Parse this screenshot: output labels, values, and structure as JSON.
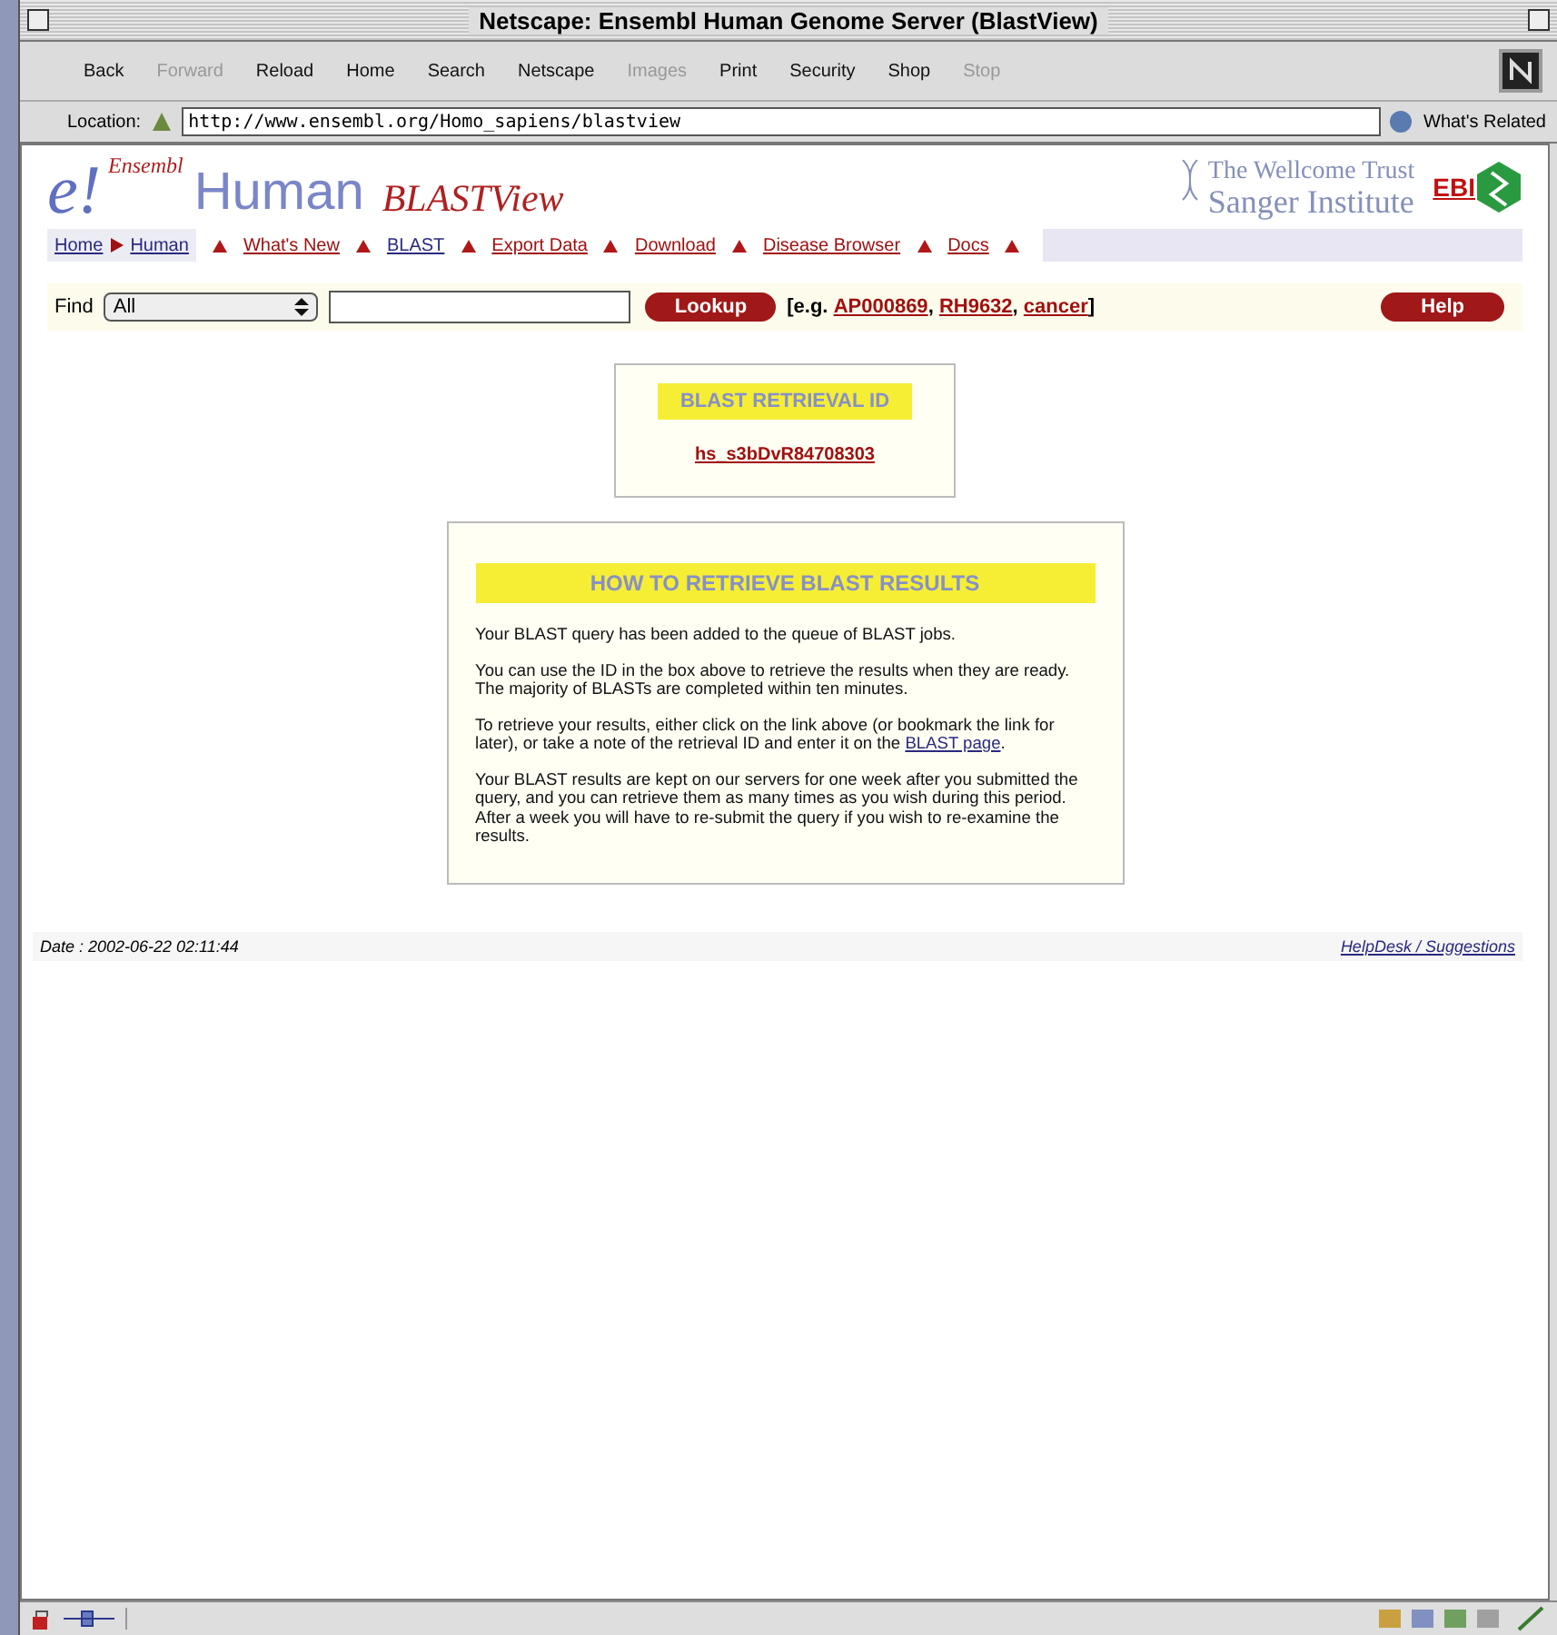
{
  "window": {
    "title": "Netscape: Ensembl Human Genome Server (BlastView)"
  },
  "toolbar": [
    {
      "label": "Back",
      "disabled": false
    },
    {
      "label": "Forward",
      "disabled": true
    },
    {
      "label": "Reload",
      "disabled": false
    },
    {
      "label": "Home",
      "disabled": false
    },
    {
      "label": "Search",
      "disabled": false
    },
    {
      "label": "Netscape",
      "disabled": false
    },
    {
      "label": "Images",
      "disabled": true
    },
    {
      "label": "Print",
      "disabled": false
    },
    {
      "label": "Security",
      "disabled": false
    },
    {
      "label": "Shop",
      "disabled": false
    },
    {
      "label": "Stop",
      "disabled": true
    }
  ],
  "location": {
    "label": "Location:",
    "value": "http://www.ensembl.org/Homo_sapiens/blastview",
    "related": "What's Related"
  },
  "header": {
    "logo_mark": "e!",
    "logo_name": "Ensembl",
    "species": "Human",
    "view": "BLASTView",
    "sanger_line1": "The Wellcome Trust",
    "sanger_line2": "Sanger Institute",
    "ebi": "EBI"
  },
  "breadcrumb": [
    "Home",
    "Human"
  ],
  "nav": [
    "What's New",
    "BLAST",
    "Export Data",
    "Download",
    "Disease Browser",
    "Docs"
  ],
  "find": {
    "label": "Find",
    "select": "All",
    "button": "Lookup",
    "examples_open": "[e.g.",
    "examples": [
      "AP000869",
      "RH9632",
      "cancer"
    ],
    "separator": ",",
    "examples_close": "]",
    "help": "Help"
  },
  "id_box": {
    "heading": "BLAST RETRIEVAL ID",
    "id": "hs_s3bDvR84708303"
  },
  "info_box": {
    "heading": "HOW TO RETRIEVE BLAST RESULTS",
    "paragraphs": [
      {
        "text": "Your BLAST query has been added to the queue of BLAST jobs."
      },
      {
        "text": "You can use the ID in the box above to retrieve the results when they are ready. The majority of BLASTs are completed within ten minutes."
      },
      {
        "text": "To retrieve your results, either click on the link above (or bookmark the link for later), or take a note of the retrieval ID and enter it on the ",
        "link": "BLAST page",
        "after": "."
      },
      {
        "text": "Your BLAST results are kept on our servers for one week after you submitted the query, and you can retrieve them as many times as you wish during this period. After a week you will have to re-submit the query if you wish to re-examine the results."
      }
    ]
  },
  "footer": {
    "date": "Date : 2002-06-22 02:11:44",
    "link": "HelpDesk / Suggestions"
  }
}
